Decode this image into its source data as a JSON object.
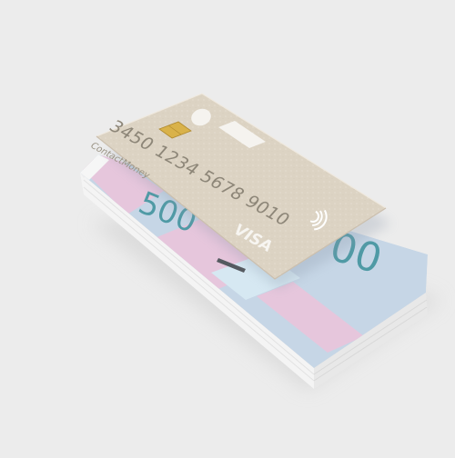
{
  "scene": {
    "background_color": "#ececec"
  },
  "card": {
    "number": "3450 1234 5678 9010",
    "bank_name": "ContactMoney",
    "network": "VISA",
    "color": "#dcd3c3",
    "chip_color": "#d9b24a",
    "icons": [
      "card-logo-circle-icon",
      "card-logo-bar-icon",
      "chip-icon",
      "contactless-icon"
    ]
  },
  "banknotes": {
    "visible_digits": [
      "500",
      "00"
    ],
    "colors": {
      "blue": "#c6d6e6",
      "pink": "#e6c6dc",
      "light_blue": "#d6e8f2",
      "white_edge": "#f6f6f6",
      "digit_color": "#4f9aa5"
    }
  }
}
